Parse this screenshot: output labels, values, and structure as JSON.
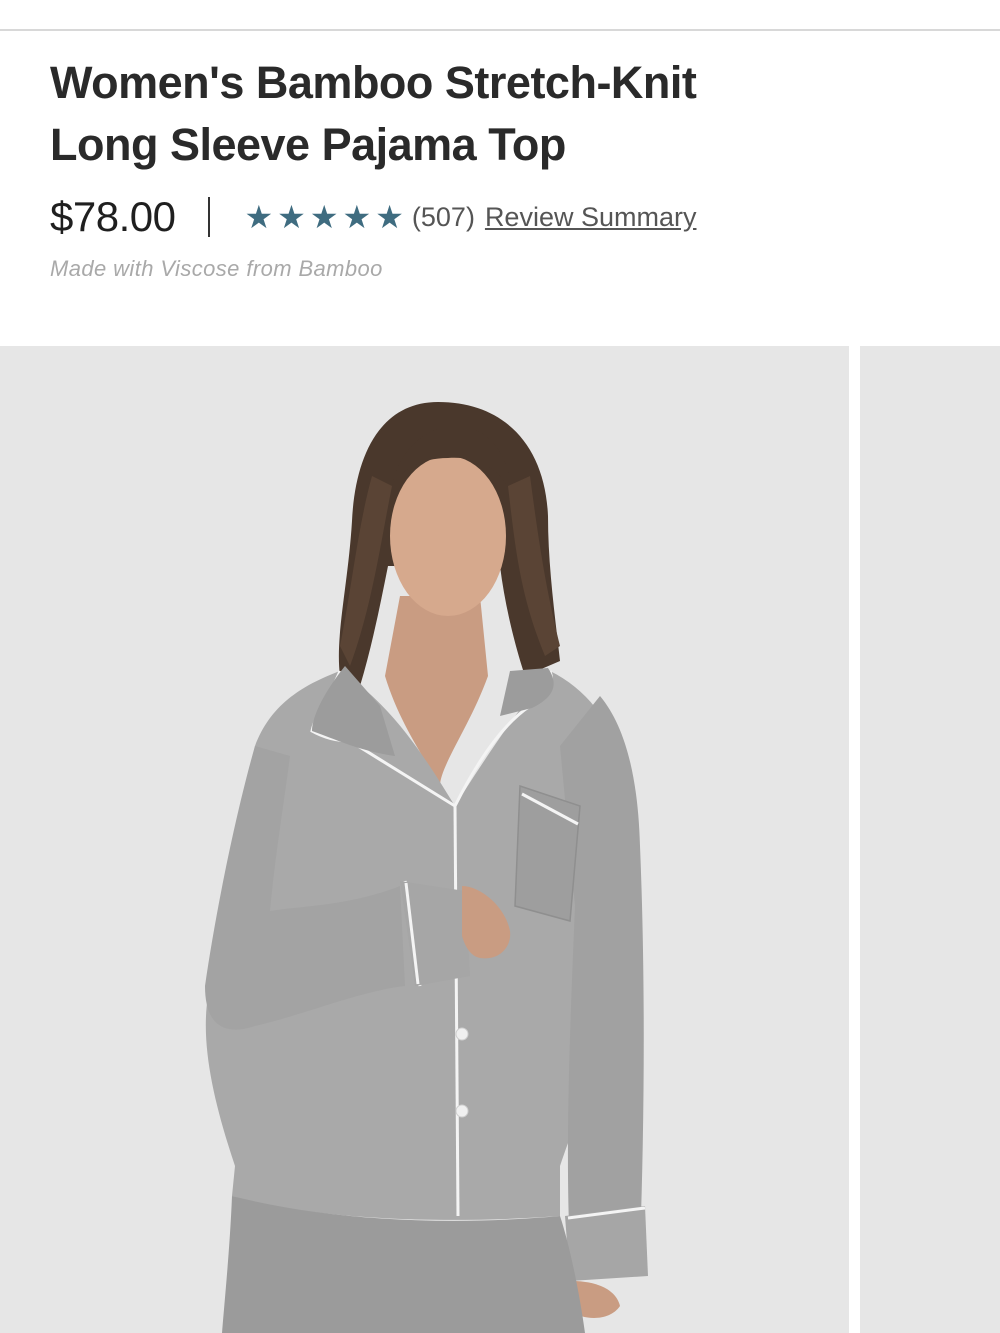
{
  "product": {
    "title_line1": "Women's Bamboo Stretch-Knit",
    "title_line2": "Long Sleeve Pajama Top",
    "price": "$78.00",
    "rating": 5,
    "review_count": "(507)",
    "review_link": "Review Summary",
    "subtitle": "Made with Viscose from Bamboo"
  },
  "rating_star_icon": "star-icon",
  "colors": {
    "star": "#3f6c80",
    "gallery_bg": "#e6e6e6"
  },
  "gallery": {
    "main_image_icon": "product-photo-grey-pajama-top",
    "slides": 2
  }
}
